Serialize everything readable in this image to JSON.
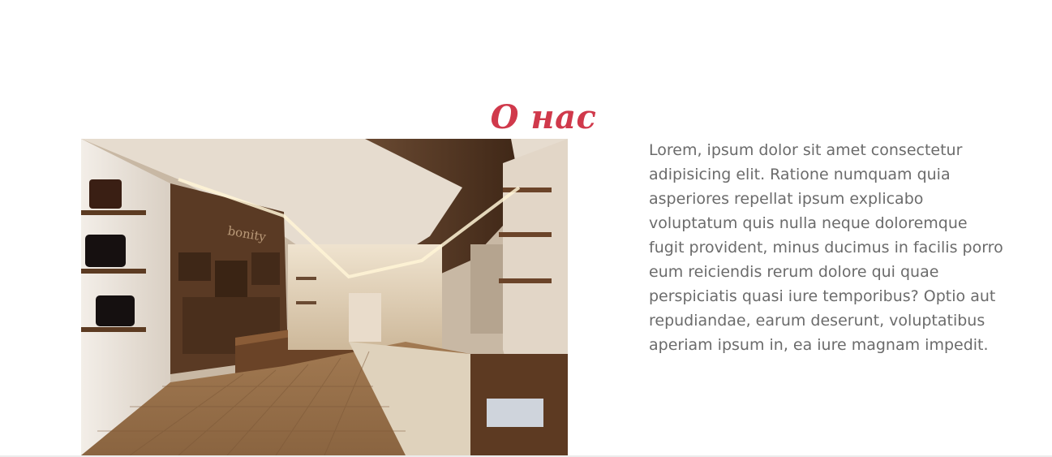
{
  "about": {
    "title": "О нас",
    "photo_alt": "Store interior",
    "photo_sign": "bonity",
    "text": "Lorem, ipsum dolor sit amet consectetur adipisicing elit. Ratione numquam quia asperiores repellat ipsum explicabo voluptatum quis nulla neque doloremque fugit provident, minus ducimus in facilis porro eum reiciendis rerum dolore qui quae perspiciatis quasi iure temporibus? Optio aut repudiandae, earum deserunt, voluptatibus aperiam ipsum in, ea iure magnam impedit."
  },
  "colors": {
    "accent": "#d0394b",
    "text": "#6b6b6b",
    "background": "#ffffff"
  }
}
